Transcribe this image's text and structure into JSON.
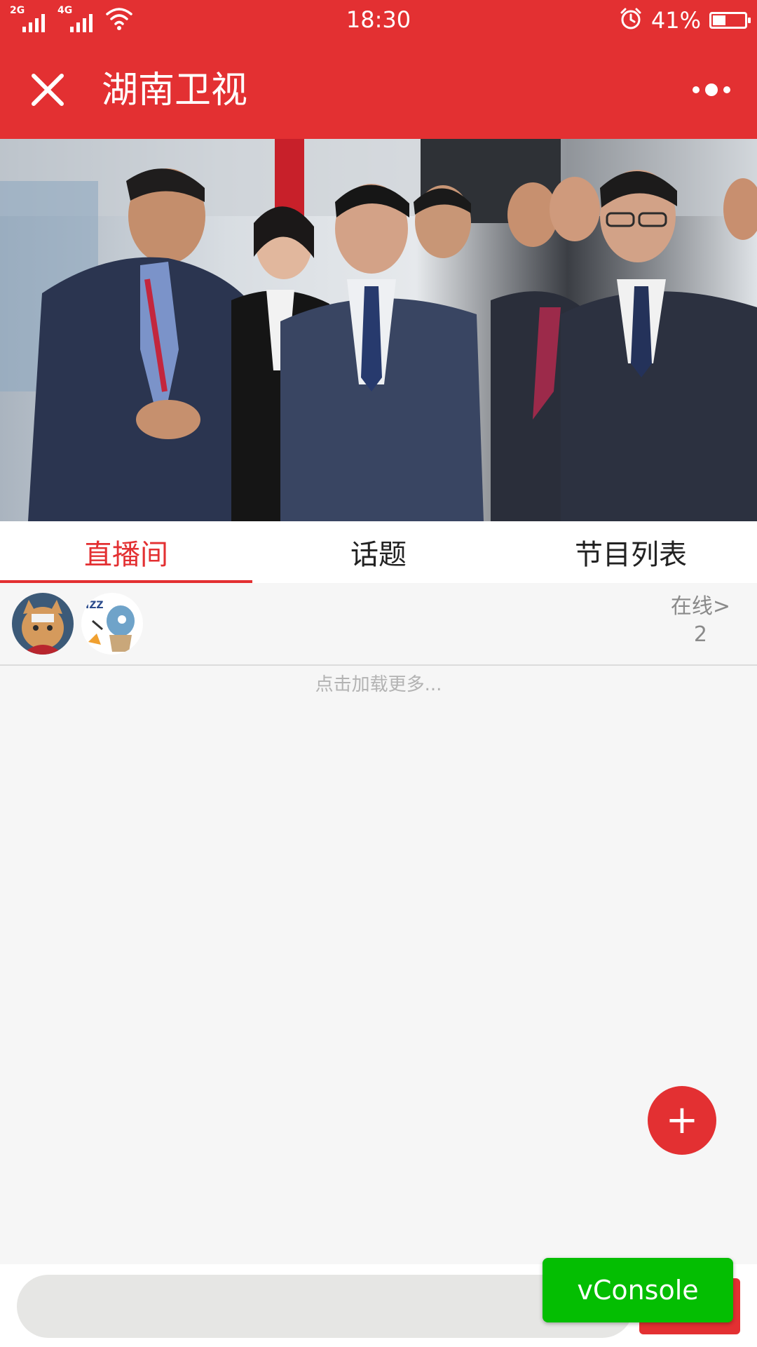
{
  "status_bar": {
    "signal1_label": "2G",
    "signal2_label": "4G",
    "time": "18:30",
    "battery_percent": "41%",
    "battery_level": 0.41,
    "icons": [
      "signal-icon",
      "wifi-icon",
      "alarm-icon",
      "battery-icon"
    ]
  },
  "header": {
    "title": "湖南卫视",
    "close_icon": "close-icon",
    "more_icon": "more-dots-icon"
  },
  "video": {
    "description_icon": "live-video-frame"
  },
  "tabs": [
    {
      "label": "直播间",
      "active": true
    },
    {
      "label": "话题",
      "active": false
    },
    {
      "label": "节目列表",
      "active": false
    }
  ],
  "viewers": {
    "online_label": "在线>",
    "online_count": "2"
  },
  "chat": {
    "load_more": "点击加载更多..."
  },
  "fab": {
    "label": "+"
  },
  "bottom": {
    "input_placeholder": "",
    "vconsole_label": "vConsole"
  },
  "colors": {
    "brand_red": "#e33032",
    "vconsole_green": "#04be02",
    "background": "#f6f6f6"
  }
}
